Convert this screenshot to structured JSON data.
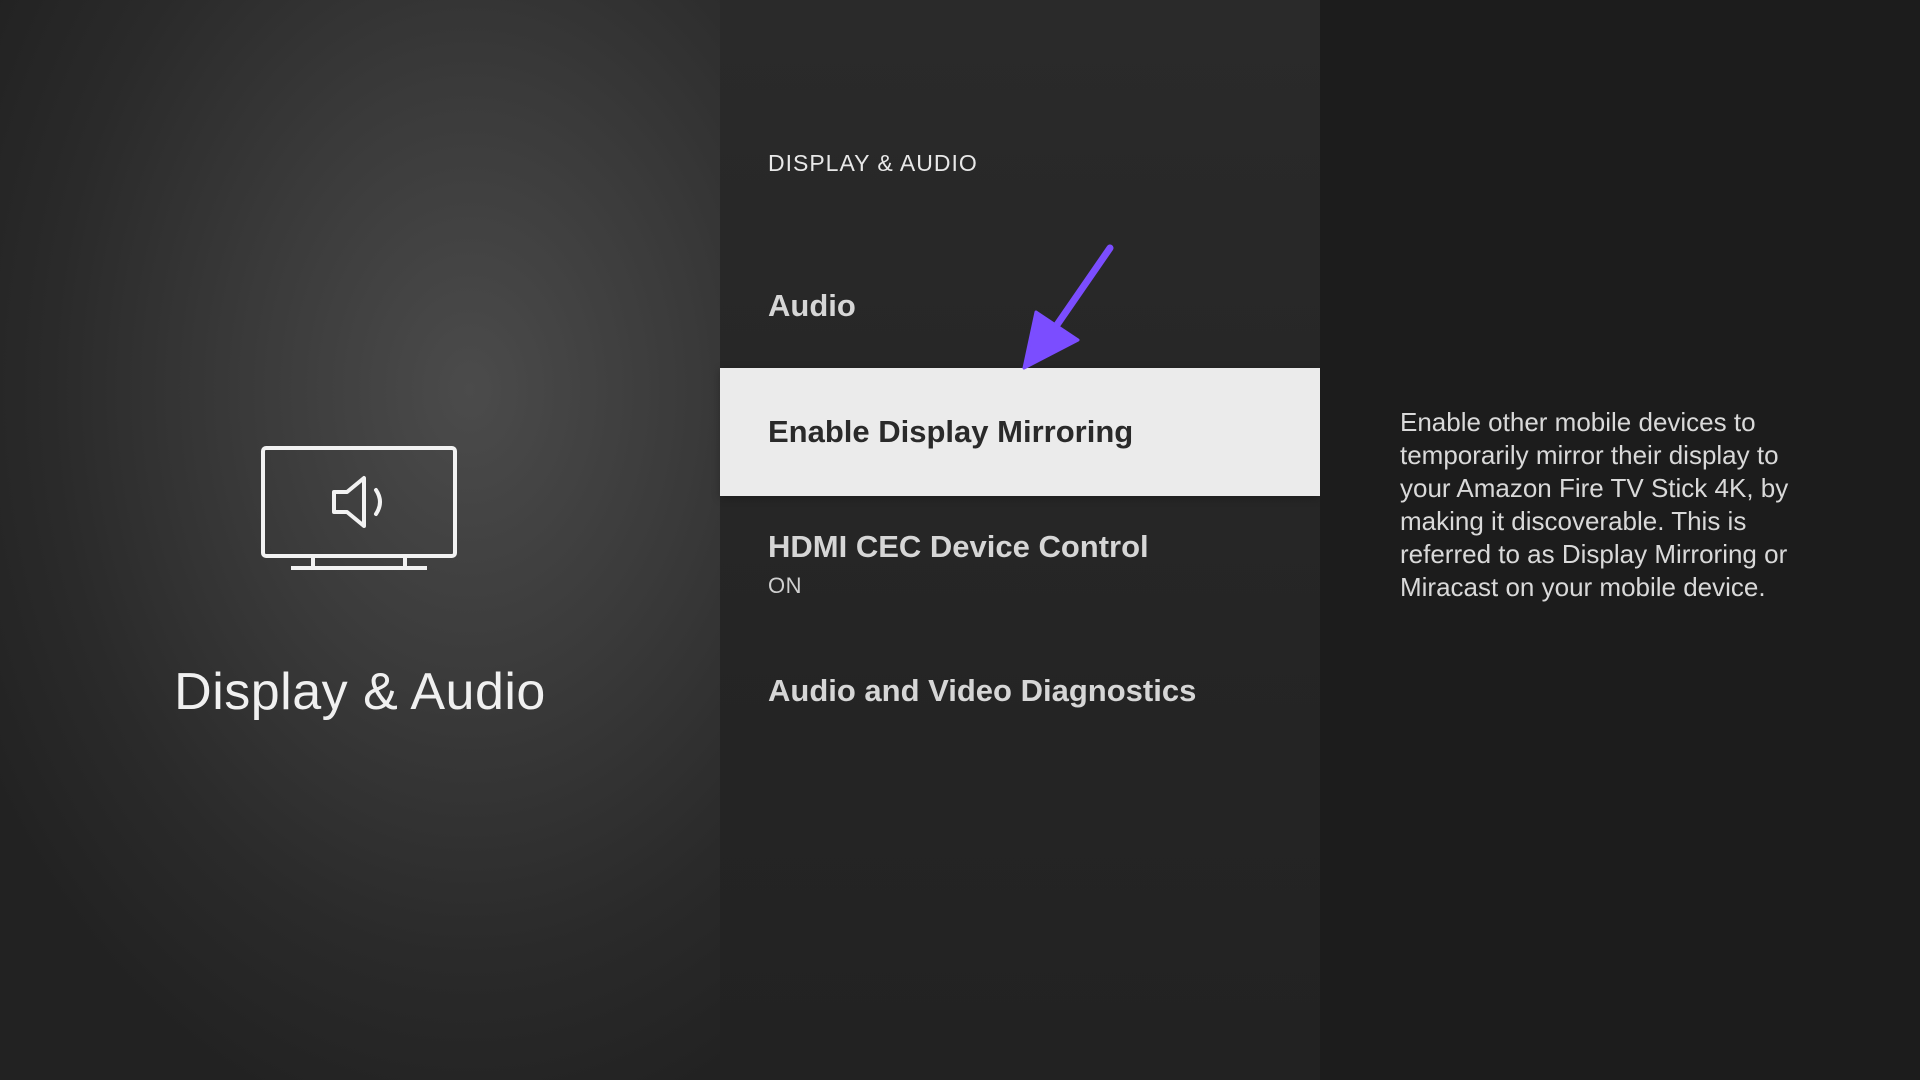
{
  "category": {
    "title": "Display & Audio",
    "icon": "tv-speaker-icon"
  },
  "menu": {
    "heading": "DISPLAY & AUDIO",
    "items": [
      {
        "label": "Audio",
        "sublabel": ""
      },
      {
        "label": "Enable Display Mirroring",
        "sublabel": "",
        "selected": true
      },
      {
        "label": "HDMI CEC Device Control",
        "sublabel": "ON"
      },
      {
        "label": "Audio and Video Diagnostics",
        "sublabel": ""
      }
    ]
  },
  "description": {
    "text": "Enable other mobile devices to temporarily mirror their display to your Amazon Fire TV Stick 4K, by making it discoverable. This is referred to as Display Mirroring or Miracast on your mobile device."
  },
  "annotation": {
    "icon": "arrow-pointer-icon",
    "color": "#7b4dff"
  },
  "colors": {
    "selected_bg": "#ebebeb",
    "selected_text": "#2a2a2a",
    "menu_text": "#d6d6d6",
    "background": "#1d1d1d"
  }
}
